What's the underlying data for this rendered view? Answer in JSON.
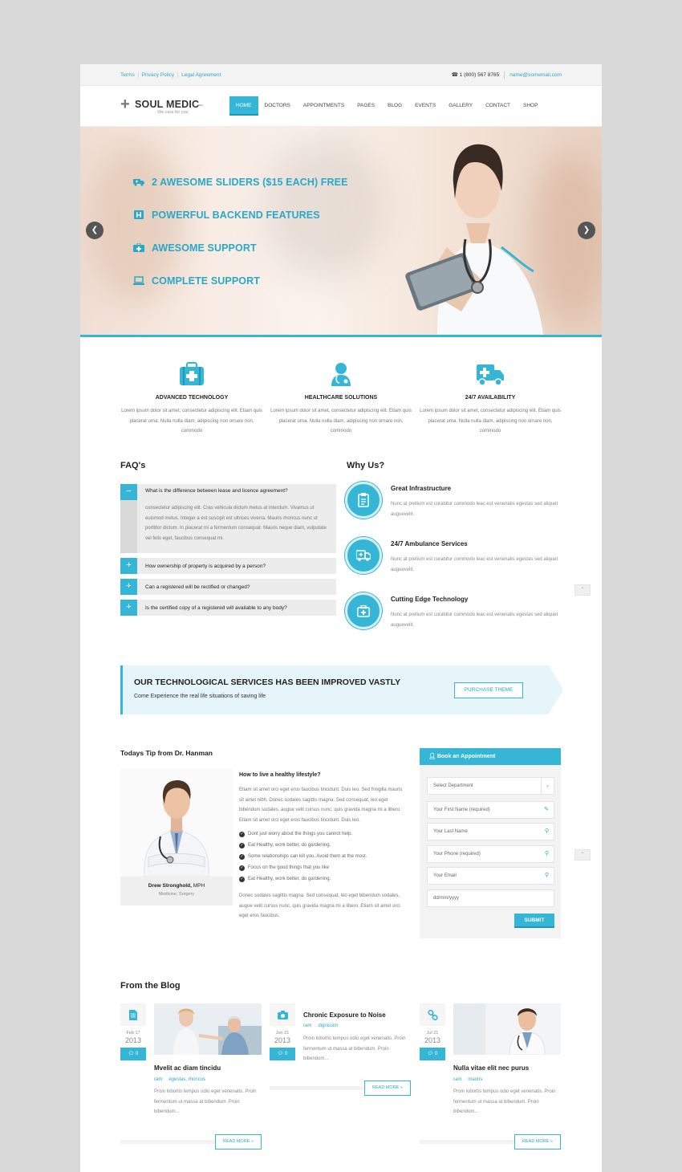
{
  "topbar": {
    "links": [
      "Terms",
      "Privacy Policy",
      "Legal Agreement"
    ],
    "phone": "1 (800) 567 8765",
    "email": "name@somemail.com"
  },
  "logo": {
    "name": "SOUL MEDIC",
    "tagline": "We care for you"
  },
  "nav": [
    "HOME",
    "DOCTORS",
    "APPOINTMENTS",
    "PAGES",
    "BLOG",
    "EVENTS",
    "GALLERY",
    "CONTACT",
    "SHOP"
  ],
  "hero": {
    "items": [
      {
        "icon": "ambulance-icon",
        "text": "2 AWESOME SLIDERS ($15 EACH) FREE"
      },
      {
        "icon": "hospital-icon",
        "text": "POWERFUL BACKEND FEATURES"
      },
      {
        "icon": "medkit-icon",
        "text": "AWESOME SUPPORT"
      },
      {
        "icon": "laptop-icon",
        "text": "COMPLETE SUPPORT"
      }
    ]
  },
  "features": [
    {
      "icon": "medkit-icon",
      "title": "ADVANCED TECHNOLOGY",
      "text": "Lorem ipsum dolor sit amet, consectetur adipiscing elit. Etiam quis placerat urna. Nulla nulla diam, adipiscing non ornare non, commodo"
    },
    {
      "icon": "doctor-icon",
      "title": "HEALTHCARE SOLUTIONS",
      "text": "Lorem ipsum dolor sit amet, consectetur adipiscing elit. Etiam quis placerat urna. Nulla nulla diam, adipiscing non ornare non, commodo"
    },
    {
      "icon": "ambulance-icon",
      "title": "24/7 AVAILABILITY",
      "text": "Lorem ipsum dolor sit amet, consectetur adipiscing elit. Etiam quis placerat urna. Nulla nulla diam, adipiscing non ornare non, commodo"
    }
  ],
  "faq": {
    "title": "FAQ's",
    "open": {
      "toggle": "−",
      "question": "What is the difference between lease and licence agreement?",
      "answer": "consectetur adipiscing elit. Cras vehicula dictum metus at interdum. Vivamus ut euismod metus. Integer a est suscipit est ultrices viverra. Mauris rhoncus nunc ut porttitor dictum. In placerat mi a fermentum consequat. Mauris neque diam, vulputate vel felis eget, faucibus consequat mi."
    },
    "closed": [
      {
        "toggle": "+",
        "question": "How ownership of property is acquired by a person?"
      },
      {
        "toggle": "+",
        "question": "Can a registered will be rectified or changed?"
      },
      {
        "toggle": "+",
        "question": "Is the certified copy of a registered will available to any body?"
      }
    ]
  },
  "why": {
    "title": "Why Us?",
    "items": [
      {
        "icon": "clipboard-icon",
        "title": "Great Infrastructure",
        "text": "Nunc at pretium est curabitur commodo leac est venenatis egestas sed aliquet auguevelit."
      },
      {
        "icon": "ambulance-icon",
        "title": "24/7 Ambulance Services",
        "text": "Nunc at pretium est curabitur commodo leac est venenatis egestas sed aliquet auguevelit."
      },
      {
        "icon": "medkit-icon",
        "title": "Cutting Edge Technology",
        "text": "Nunc at pretium est curabitur commodo leac est venenatis egestas sed aliquet auguevelit."
      }
    ]
  },
  "cta": {
    "title": "OUR TECHNOLOGICAL SERVICES HAS BEEN IMPROVED VASTLY",
    "subtitle": "Come Experience the real life situations of saving life",
    "button": "PURCHASE THEME"
  },
  "tip": {
    "title": "Todays Tip from Dr. Hanman",
    "doctor_name": "Drew Stronghold,",
    "doctor_degree": " MPH",
    "doctor_role": "Medicine, Surgery",
    "heading": "How to live a healthy lifestyle?",
    "para1": "Etiam sit amet orci eget eros faucibus tincidunt. Duis leo. Sed fringilla mauris sit amet nibh. Donec sodales sagittis magna. Sed consequat, leo eget bibendum sodales, augue velit cursus nunc, quis gravida magna mi a libero. Etiam sit amet orci eget eros faucibus tincidunt. Duis leo.",
    "bullets": [
      "Dont just worry about the things you cannot help.",
      "Eat Healthy, work better, do gardening.",
      "Some relationships can kill you. Avoid them at the most.",
      "Focus on the good things that you like",
      "Eat Healthy, work better, do gardening."
    ],
    "para2": "Donec sodales sagittis magna. Sed consequat, leo eget bibendum sodales, augue velit cursus nunc, quis gravida magna mi a libero. Etiam sit amet orci eget eros faucibus."
  },
  "appointment": {
    "title": "Book an Appointment",
    "fields": [
      {
        "text": "Select Department",
        "icon": "chevron-down-icon"
      },
      {
        "text": "Your First Name (required)",
        "icon": "edit-icon"
      },
      {
        "text": "Your Last Name",
        "icon": "pin-icon"
      },
      {
        "text": "Your Phone (required)",
        "icon": "pin-icon"
      },
      {
        "text": "Your Email",
        "icon": "pin-icon"
      },
      {
        "text": "dd/mm/yyyy",
        "icon": ""
      }
    ],
    "submit": "SUBMIT"
  },
  "blog": {
    "title": "From the Blog",
    "posts": [
      {
        "icon": "document-icon",
        "date": "Feb 17",
        "year": "2013",
        "comments": "0",
        "title": "Mvelit ac diam tincidu",
        "author": "ram",
        "tags": "egestas, rhoncus",
        "excerpt": "Proin lobortis tempus odio eget venenatis. Proin fermentum ut massa at bibendum. Proin bibendum...",
        "more": "READ MORE »"
      },
      {
        "icon": "camera-icon",
        "date": "Jun 21",
        "year": "2013",
        "comments": "0",
        "title": "Chronic Exposure to Noise",
        "author": "ram",
        "tags": "dignissim",
        "excerpt": "Proin lobortis tempus odio eget venenatis. Proin fermentum ut massa at bibendum. Proin bibendum...",
        "more": "READ MORE »"
      },
      {
        "icon": "link-icon",
        "date": "Jul 21",
        "year": "2013",
        "comments": "0",
        "title": "Nulla vitae elit nec purus",
        "author": "ram",
        "tags": "mauris",
        "excerpt": "Proin lobortis tempus odio eget venenatis. Proin fermentum ut massa at bibendum. Proin bibendum...",
        "more": "READ MORE »"
      }
    ]
  },
  "colors": {
    "accent": "#36b6d6",
    "link": "#2aa8c9",
    "cta_bg": "#e6f5fa"
  }
}
